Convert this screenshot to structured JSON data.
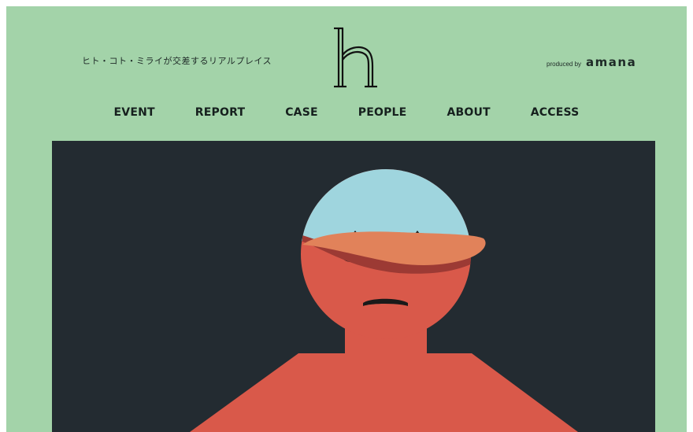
{
  "header": {
    "tagline": "ヒト・コト・ミライが交差するリアルプレイス",
    "logo_letter": "h",
    "produced_by": "produced by",
    "brand": "amana"
  },
  "nav": {
    "items": [
      {
        "label": "EVENT"
      },
      {
        "label": "REPORT"
      },
      {
        "label": "CASE"
      },
      {
        "label": "PEOPLE"
      },
      {
        "label": "ABOUT"
      },
      {
        "label": "ACCESS"
      }
    ]
  },
  "colors": {
    "page_background": "#a3d3a9",
    "hero_background": "#232b31",
    "figure_head_top": "#9fd5de",
    "figure_body": "#d9594a",
    "figure_visor": "#e1825a",
    "nav_text": "#16201e"
  }
}
